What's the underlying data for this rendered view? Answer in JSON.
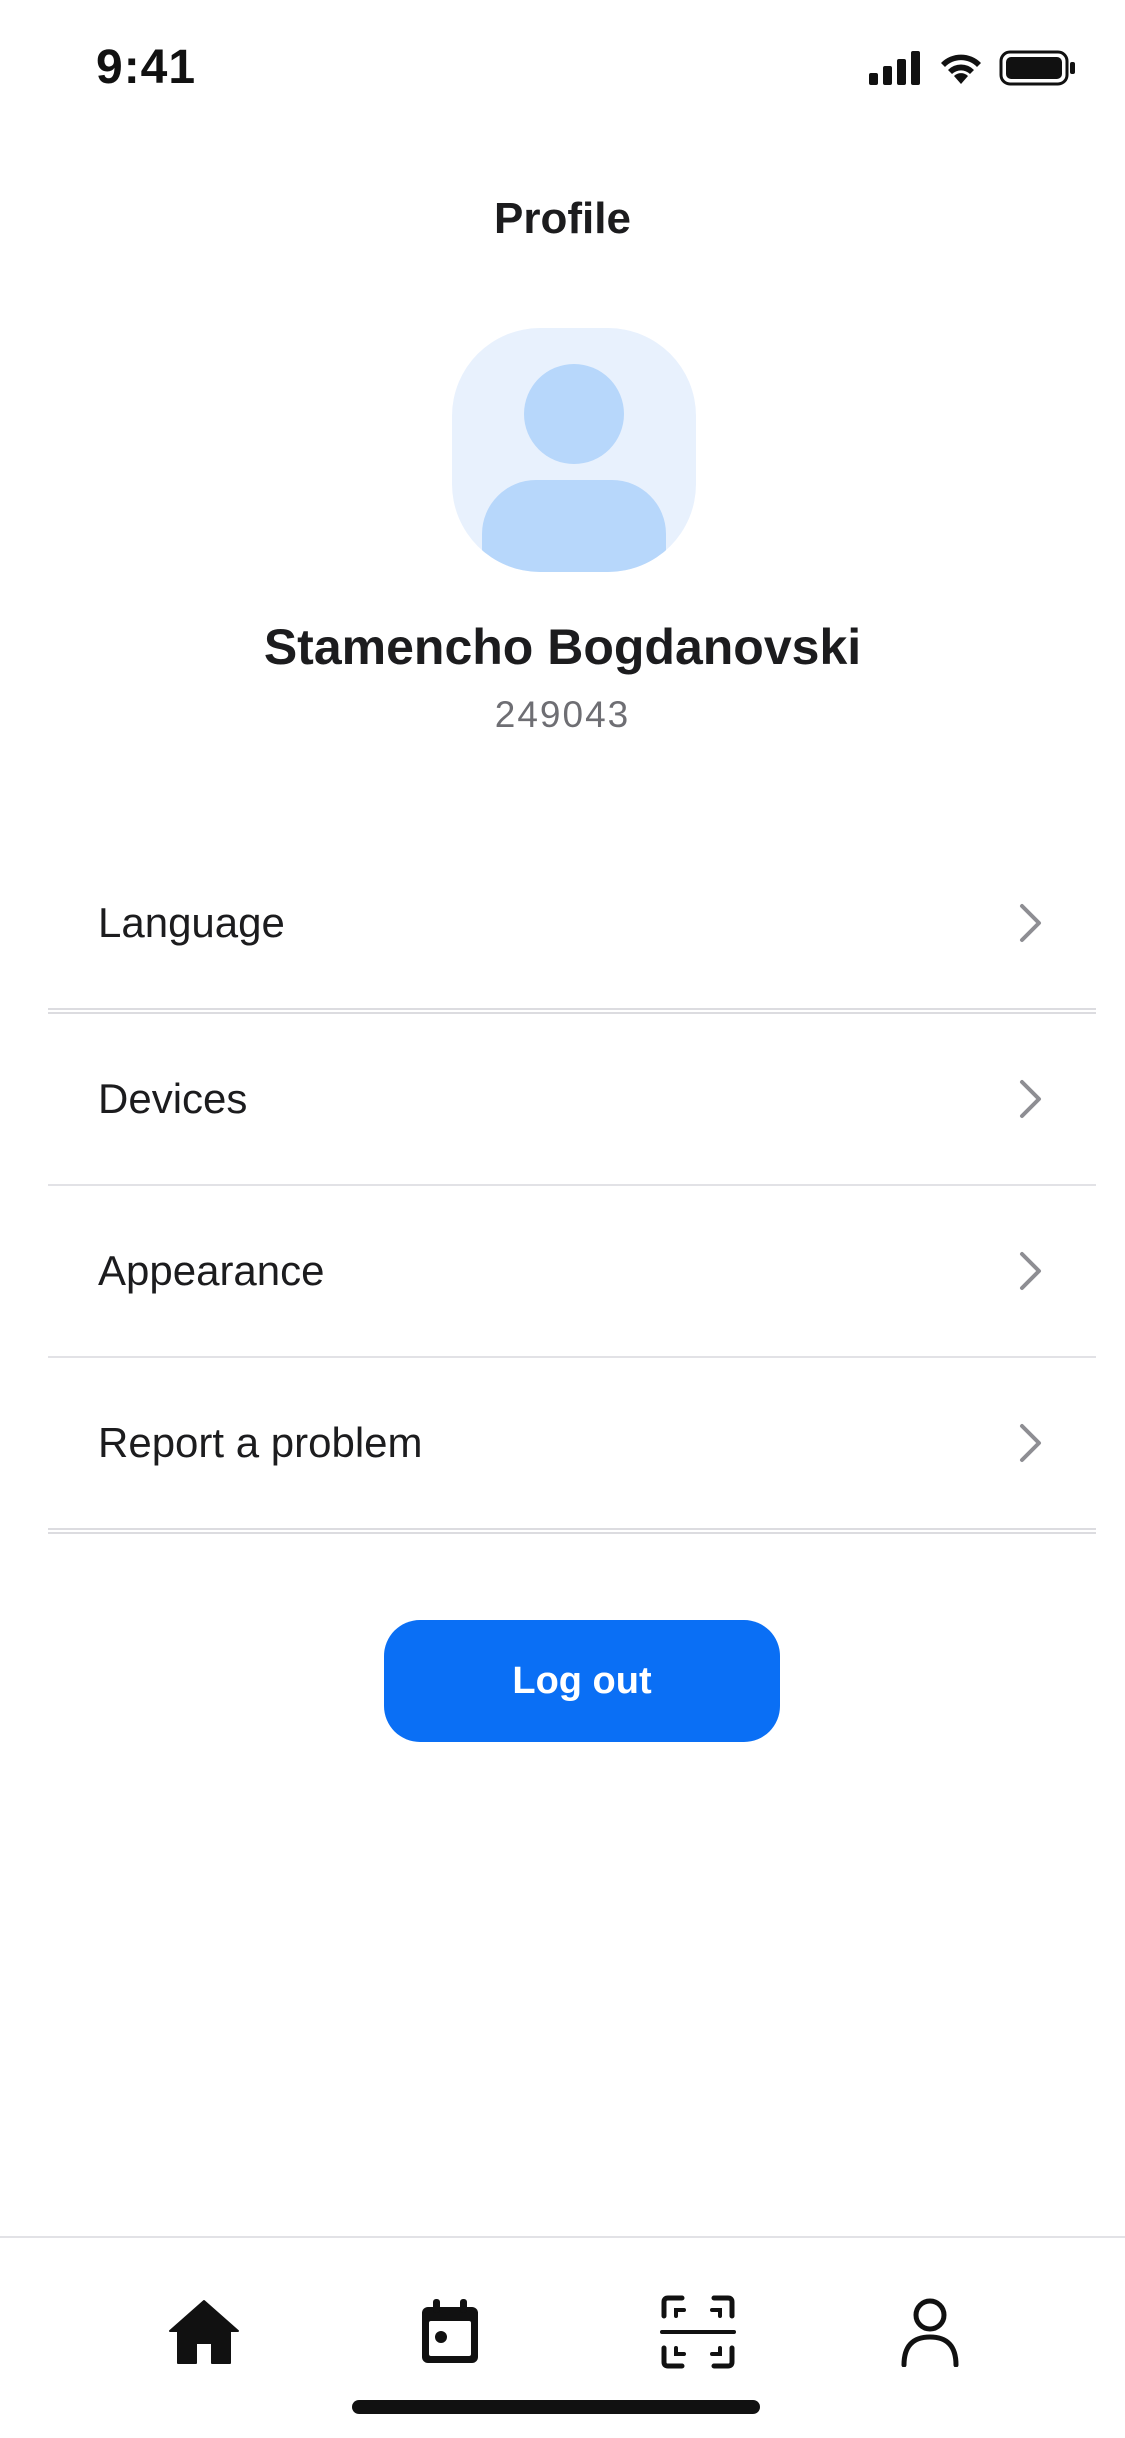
{
  "status_bar": {
    "time": "9:41"
  },
  "header": {
    "title": "Profile"
  },
  "profile": {
    "name": "Stamencho Bogdanovski",
    "id": "249043"
  },
  "menu": {
    "items": [
      {
        "label": "Language"
      },
      {
        "label": "Devices"
      },
      {
        "label": "Appearance"
      },
      {
        "label": "Report a problem"
      }
    ]
  },
  "logout": {
    "label": "Log out"
  },
  "tab_bar": {
    "tabs": [
      {
        "icon": "home-icon"
      },
      {
        "icon": "calendar-icon"
      },
      {
        "icon": "scan-icon"
      },
      {
        "icon": "profile-icon"
      }
    ]
  },
  "colors": {
    "accent": "#0A6FF5",
    "avatar_bg": "#E8F1FD",
    "avatar_fg": "#B7D7FB",
    "divider": "#E2E2E6",
    "secondary_text": "#6E6E73"
  }
}
